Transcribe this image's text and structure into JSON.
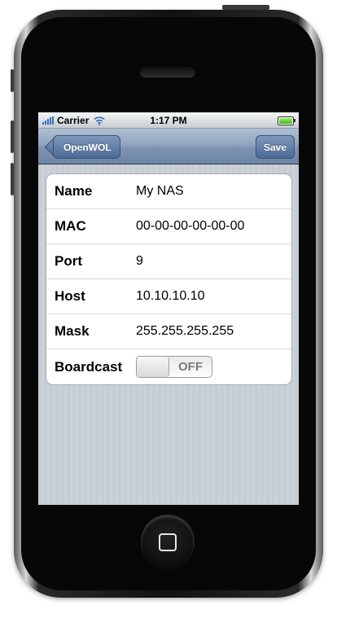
{
  "status_bar": {
    "carrier": "Carrier",
    "time": "1:17 PM",
    "battery_level": 1.0,
    "signal_bars": 5,
    "wifi_icon": "wifi-icon"
  },
  "nav_bar": {
    "back_label": "OpenWOL",
    "save_label": "Save"
  },
  "form": {
    "rows": [
      {
        "label": "Name",
        "value": "My NAS"
      },
      {
        "label": "MAC",
        "value": "00-00-00-00-00-00"
      },
      {
        "label": "Port",
        "value": "9"
      },
      {
        "label": "Host",
        "value": "10.10.10.10"
      },
      {
        "label": "Mask",
        "value": "255.255.255.255"
      }
    ],
    "broadcast": {
      "label": "Boardcast",
      "switch_text": "OFF",
      "on": false
    }
  },
  "colors": {
    "nav_bar": "#6d85a6",
    "nav_button": "#4c6a96",
    "background": "#c5ccd4"
  }
}
